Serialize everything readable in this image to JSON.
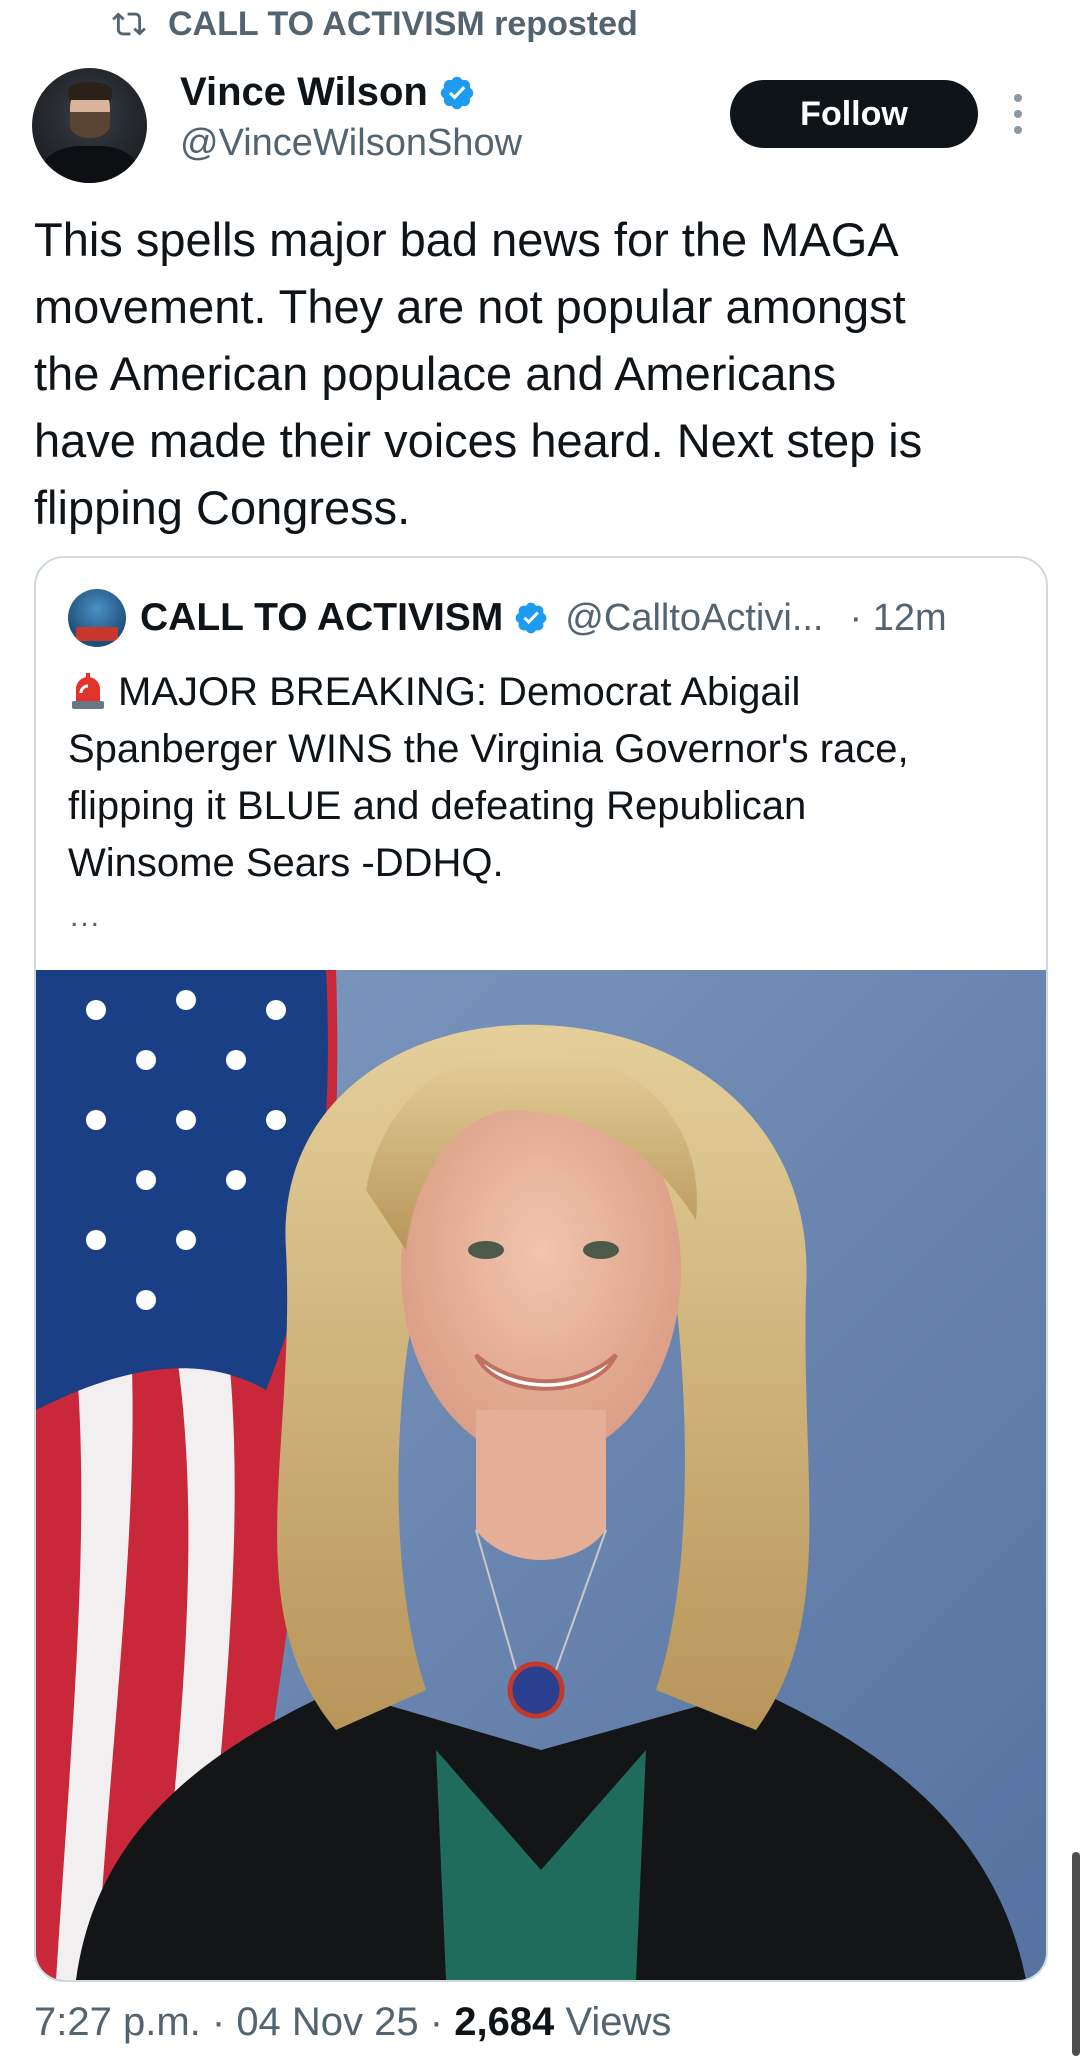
{
  "repost": {
    "text": "CALL TO ACTIVISM reposted",
    "icon": "repost-icon"
  },
  "author": {
    "name": "Vince Wilson",
    "handle": "@VinceWilsonShow",
    "verified": true
  },
  "follow_label": "Follow",
  "tweet": {
    "line1": "This spells major bad news for the MAGA",
    "line2": "movement. They are not popular amongst",
    "line3": "the American populace and Americans",
    "line4": "have made their voices heard. Next step is",
    "line5": "flipping Congress."
  },
  "quote": {
    "name": "CALL TO ACTIVISM",
    "handle": "@CalltoActivi...",
    "time": "· 12m",
    "line1": "MAJOR BREAKING: Democrat Abigail",
    "line2": "Spanberger WINS the Virginia Governor's race,",
    "line3": "flipping it BLUE and defeating Republican",
    "line4": "Winsome Sears -DDHQ.",
    "ellipsis": "...",
    "image_alt": "portrait photo"
  },
  "footer": {
    "time": "7:27 p.m.",
    "sep": " · ",
    "date": "04 Nov 25",
    "views_count": "2,684",
    "views_label": "Views"
  },
  "colors": {
    "text": "#0f1419",
    "muted": "#536471",
    "verified": "#1d9bf0",
    "follow_bg": "#0f1419",
    "border": "#cfd9de"
  }
}
